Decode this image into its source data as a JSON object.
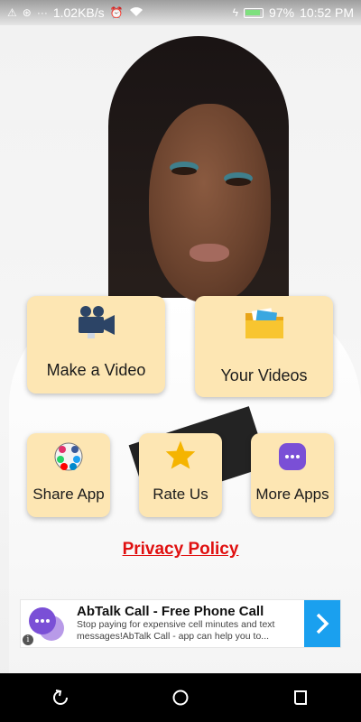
{
  "status_bar": {
    "network_speed": "1.02KB/s",
    "battery": "97%",
    "time": "10:52 PM",
    "icons": [
      "warning-icon",
      "vpn-icon",
      "more-dots-icon",
      "alarm-icon",
      "wifi-icon",
      "charging-icon",
      "battery-icon"
    ]
  },
  "menu": {
    "make_video": {
      "label": "Make a Video",
      "icon": "video-camera-icon"
    },
    "your_videos": {
      "label": "Your Videos",
      "icon": "folder-icon"
    },
    "share_app": {
      "label": "Share App",
      "icon": "share-apps-icon"
    },
    "rate_us": {
      "label": "Rate Us",
      "icon": "star-icon"
    },
    "more_apps": {
      "label": "More Apps",
      "icon": "more-apps-icon"
    }
  },
  "privacy_policy": {
    "label": "Privacy Policy",
    "color": "#e01010"
  },
  "ad": {
    "title": "AbTalk Call - Free Phone Call",
    "description": "Stop paying for expensive cell minutes and text messages!AbTalk Call - app can help you to...",
    "info_label": "i",
    "accent": "#1aa0ef"
  },
  "nav": [
    "back-icon",
    "home-icon",
    "recents-icon"
  ],
  "colors": {
    "card": "#fde6b3",
    "nav_bar": "#000000"
  }
}
